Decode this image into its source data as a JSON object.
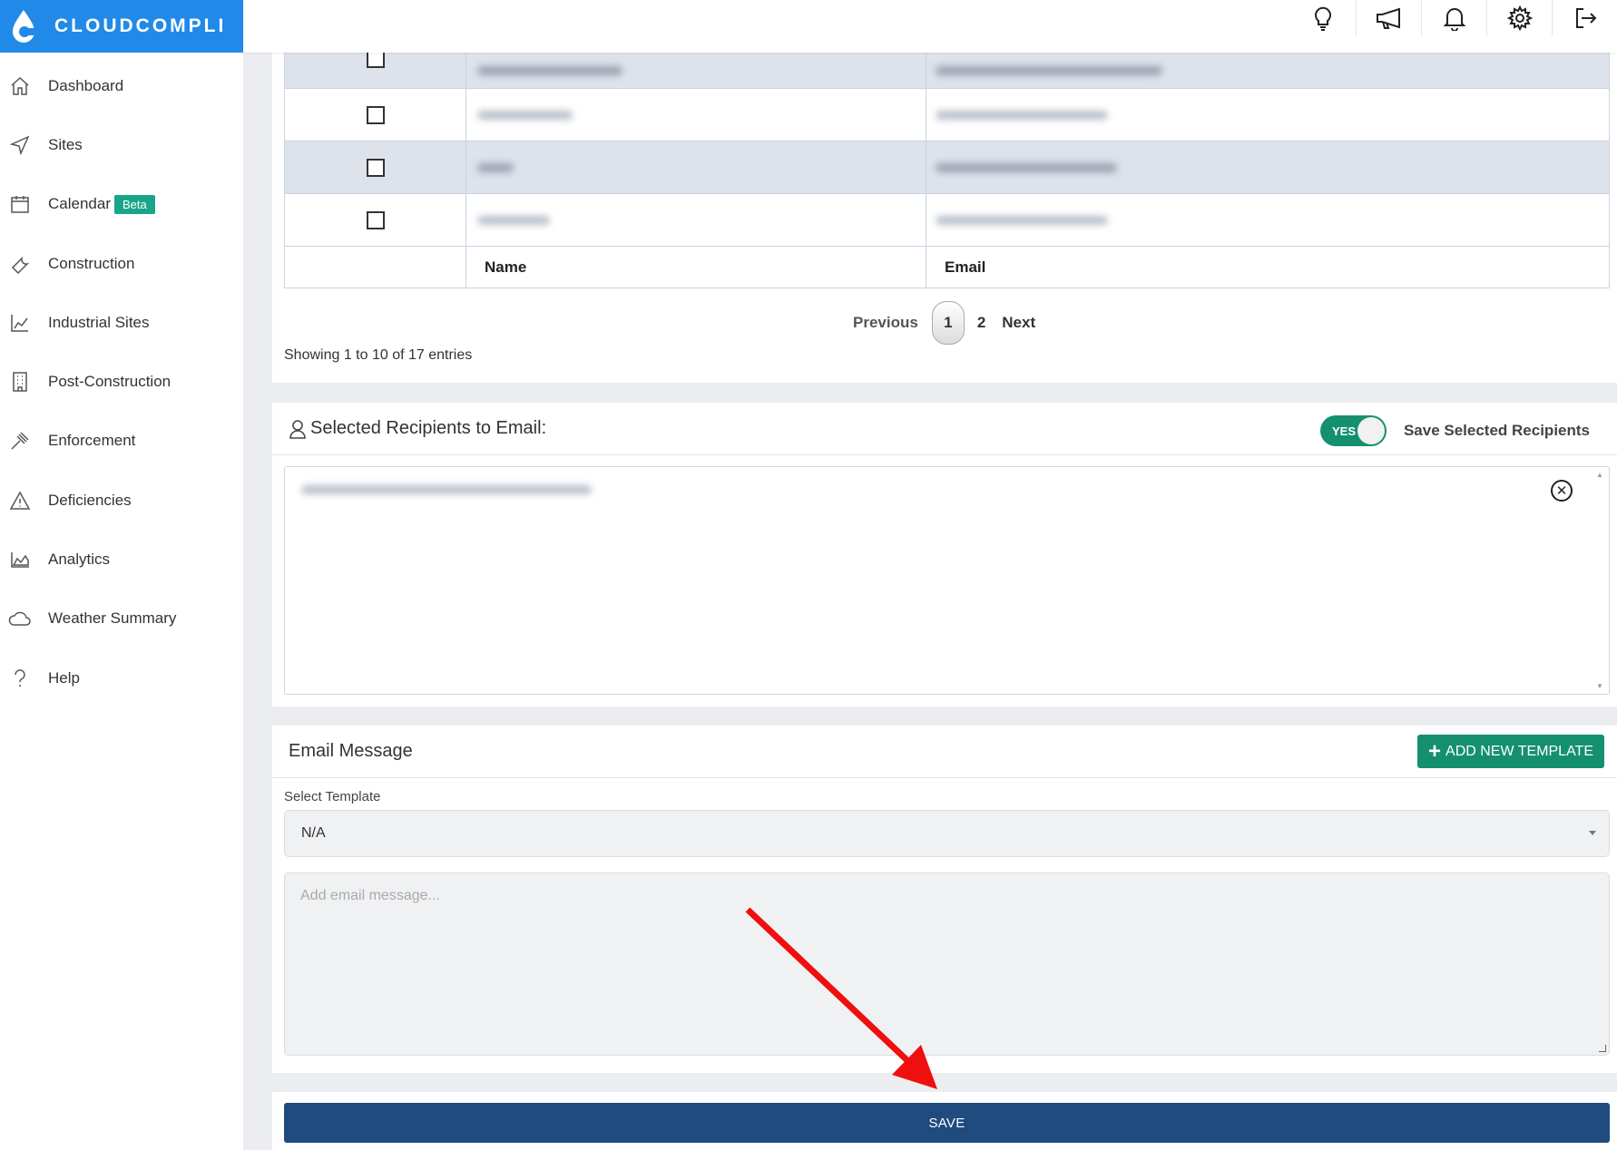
{
  "app": {
    "logo_text": "CLOUDCOMPLI",
    "brand_color": "#2189e8",
    "accent_color": "#14906e",
    "save_color": "#1f4b7e"
  },
  "sidebar": {
    "items": [
      {
        "label": "Dashboard",
        "icon": "home-icon"
      },
      {
        "label": "Sites",
        "icon": "send-icon"
      },
      {
        "label": "Calendar",
        "icon": "calendar-icon",
        "badge": "Beta"
      },
      {
        "label": "Construction",
        "icon": "wrench-icon"
      },
      {
        "label": "Industrial Sites",
        "icon": "factory-icon"
      },
      {
        "label": "Post-Construction",
        "icon": "building-icon"
      },
      {
        "label": "Enforcement",
        "icon": "gavel-icon"
      },
      {
        "label": "Deficiencies",
        "icon": "warning-icon"
      },
      {
        "label": "Analytics",
        "icon": "area-chart-icon"
      },
      {
        "label": "Weather Summary",
        "icon": "cloud-icon"
      },
      {
        "label": "Help",
        "icon": "question-icon"
      }
    ]
  },
  "topbar": {
    "icons": [
      "lightbulb-icon",
      "megaphone-icon",
      "bell-icon",
      "gear-icon",
      "logout-icon"
    ]
  },
  "table": {
    "headers": {
      "name": "Name",
      "email": "Email"
    },
    "rows": [
      {
        "name_blurred": true,
        "email_blurred": true
      },
      {
        "name_blurred": true,
        "email_blurred": true
      },
      {
        "name_blurred": true,
        "email_blurred": true
      },
      {
        "name_blurred": true,
        "email_blurred": true
      }
    ]
  },
  "pagination": {
    "previous": "Previous",
    "current": "1",
    "page2": "2",
    "next": "Next"
  },
  "table_info": "Showing 1 to 10 of 17 entries",
  "recipients": {
    "title": "Selected Recipients to Email:",
    "toggle_text": "YES",
    "toggle_label": "Save Selected Recipients"
  },
  "email": {
    "title": "Email Message",
    "add_template": "ADD NEW TEMPLATE",
    "template_label": "Select Template",
    "template_value": "N/A",
    "message_placeholder": "Add email message..."
  },
  "save_label": "SAVE"
}
